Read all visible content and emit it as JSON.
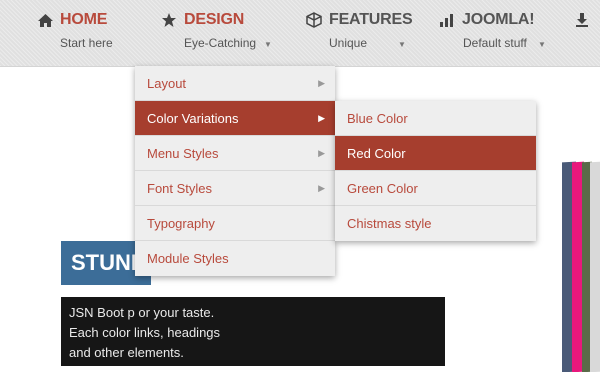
{
  "nav": [
    {
      "icon": "home-icon",
      "label": "HOME",
      "sub": "Start here",
      "active": true
    },
    {
      "icon": "star-icon",
      "label": "DESIGN",
      "sub": "Eye-Catching",
      "active": true
    },
    {
      "icon": "cube-icon",
      "label": "FEATURES",
      "sub": "Unique"
    },
    {
      "icon": "bar-chart-icon",
      "label": "JOOMLA!",
      "sub": "Default stuff"
    },
    {
      "icon": "download-icon",
      "label": ""
    }
  ],
  "dropdown": {
    "items": [
      {
        "label": "Layout",
        "has_sub": true
      },
      {
        "label": "Color Variations",
        "has_sub": true,
        "active": true
      },
      {
        "label": "Menu Styles",
        "has_sub": true
      },
      {
        "label": "Font Styles",
        "has_sub": true
      },
      {
        "label": "Typography"
      },
      {
        "label": "Module Styles"
      }
    ]
  },
  "submenu": {
    "items": [
      {
        "label": "Blue Color"
      },
      {
        "label": "Red Color",
        "active": true
      },
      {
        "label": "Green Color"
      },
      {
        "label": "Chistmas style"
      }
    ]
  },
  "content": {
    "banner": "STUNNING",
    "lines": [
      "JSN Boot p                                    or your taste.",
      "Each color                                     links, headings",
      "and other elements."
    ]
  },
  "colors": {
    "accent": "#a63e2e",
    "nav_active": "#b84a3c",
    "banner": "#3c6d98",
    "stripes": [
      "#4a5a78",
      "#e8187c",
      "#5a6a48",
      "#d9d9d9"
    ]
  }
}
